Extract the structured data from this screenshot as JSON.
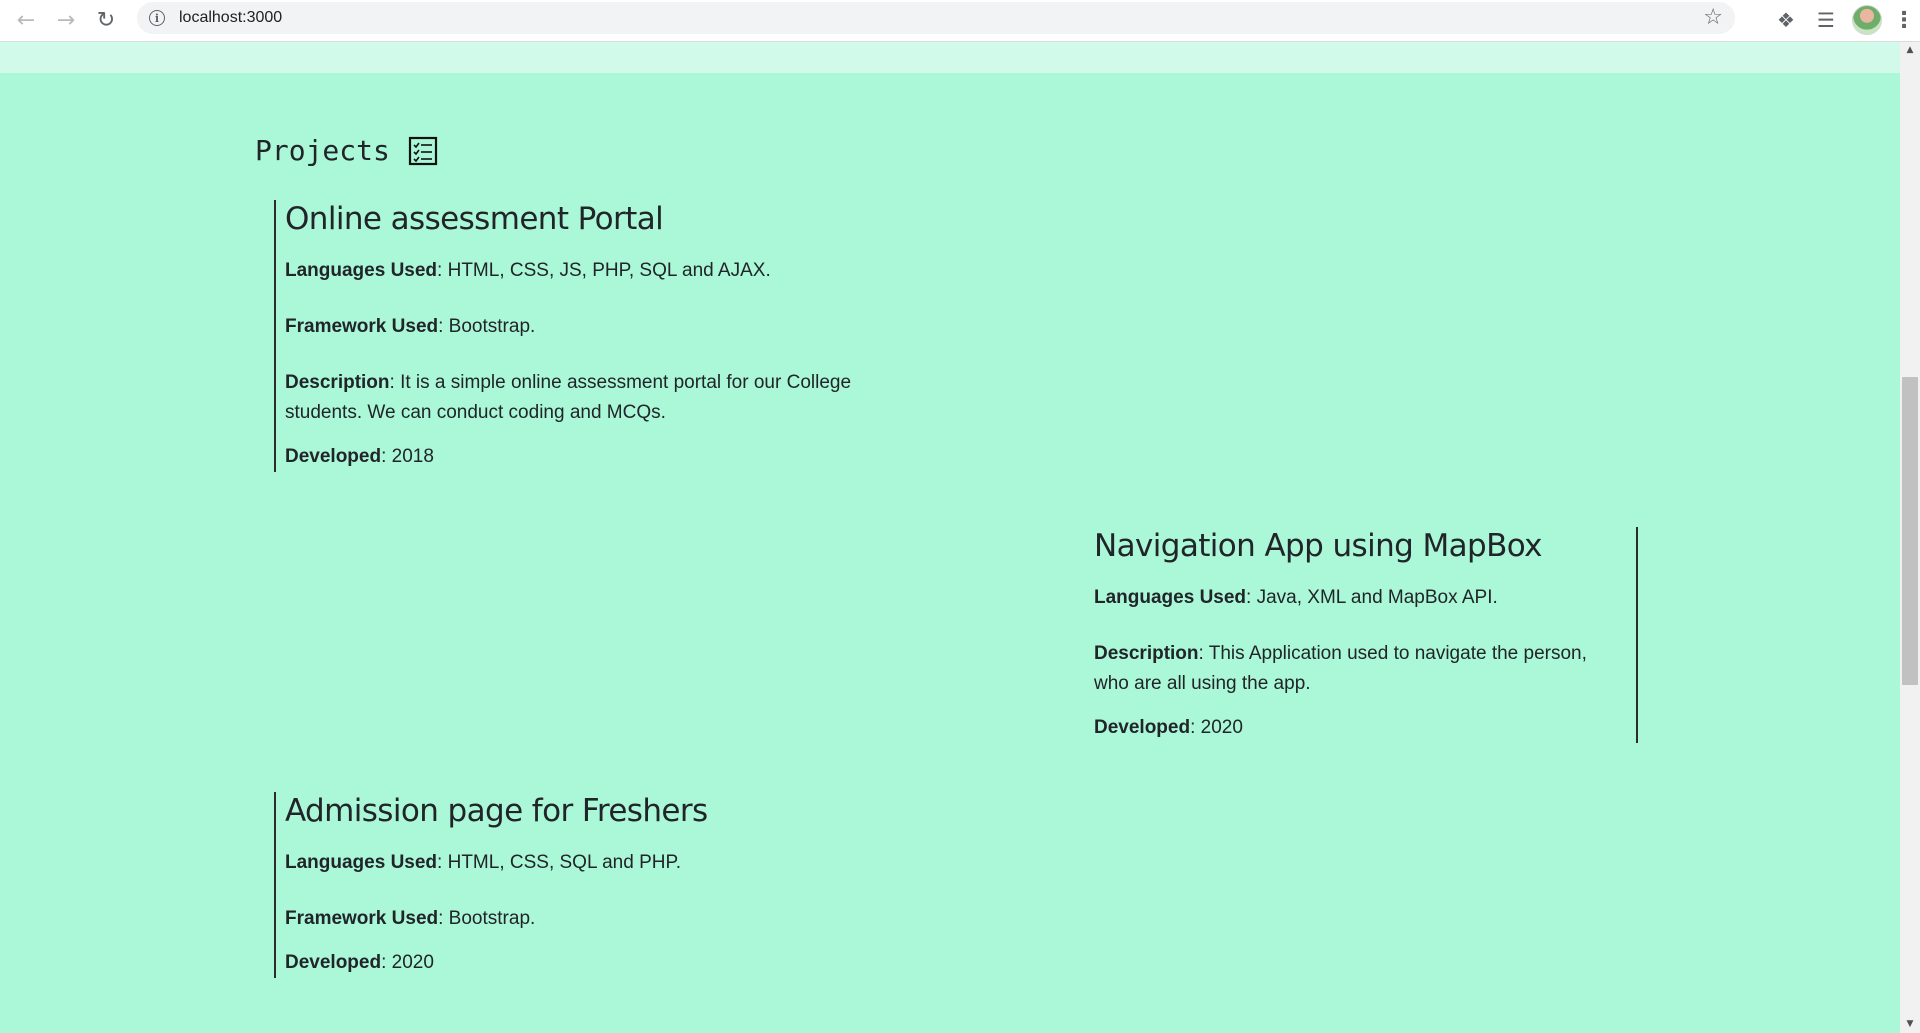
{
  "browser": {
    "url": "localhost:3000"
  },
  "section": {
    "title": "Projects"
  },
  "projects": [
    {
      "title": "Online assessment Portal",
      "languages_label": "Languages Used",
      "languages": ": HTML, CSS, JS, PHP, SQL and AJAX.",
      "framework_label": "Framework Used",
      "framework": ": Bootstrap.",
      "description_label": "Description",
      "description": ": It is a simple online assessment portal for our College students. We can conduct coding and MCQs.",
      "developed_label": "Developed",
      "developed": ": 2018"
    },
    {
      "title": "Navigation App using MapBox",
      "languages_label": "Languages Used",
      "languages": ": Java, XML and MapBox API.",
      "description_label": "Description",
      "description": ": This Application used to navigate the person, who are all using the app.",
      "developed_label": "Developed",
      "developed": ": 2020"
    },
    {
      "title": "Admission page for Freshers",
      "languages_label": "Languages Used",
      "languages": ": HTML, CSS, SQL and PHP.",
      "framework_label": "Framework Used",
      "framework": ": Bootstrap.",
      "developed_label": "Developed",
      "developed": ": 2020"
    }
  ],
  "colors": {
    "page_background": "#aaf8d8",
    "header_strip": "#d2faea",
    "text": "#212529"
  }
}
